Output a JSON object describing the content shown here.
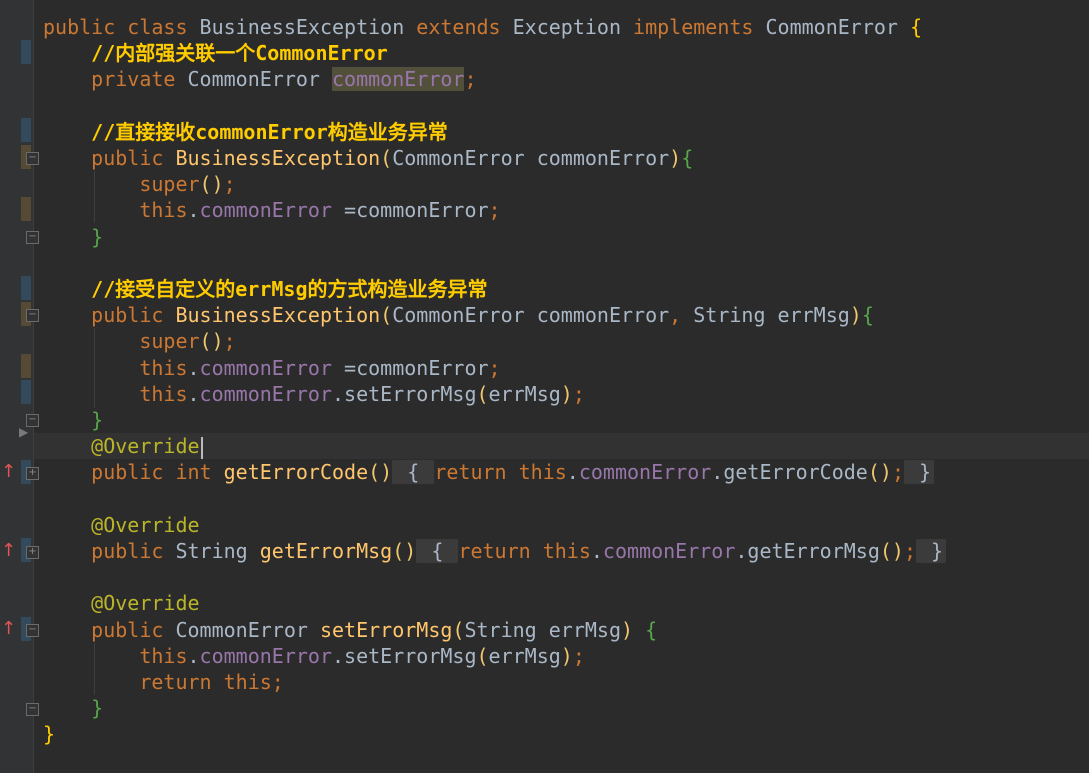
{
  "editor": {
    "lines": [
      {
        "parts": [
          {
            "c": "kw",
            "t": "public class "
          },
          {
            "c": "id",
            "t": "BusinessException "
          },
          {
            "c": "kw",
            "t": "extends "
          },
          {
            "c": "id",
            "t": "Exception "
          },
          {
            "c": "kw",
            "t": "implements "
          },
          {
            "c": "id",
            "t": "CommonError "
          },
          {
            "c": "brace1",
            "t": "{"
          }
        ]
      },
      {
        "parts": [
          {
            "c": "cmt",
            "t": "    //内部强关联一个CommonError"
          }
        ]
      },
      {
        "parts": [
          {
            "c": "kw",
            "t": "    private "
          },
          {
            "c": "id",
            "t": "CommonError "
          },
          {
            "c": "fld hl",
            "t": "commonError"
          },
          {
            "c": "pn",
            "t": ";"
          }
        ]
      },
      {
        "parts": []
      },
      {
        "parts": [
          {
            "c": "cmt",
            "t": "    //直接接收commonError构造业务异常"
          }
        ]
      },
      {
        "parts": [
          {
            "c": "kw",
            "t": "    public "
          },
          {
            "c": "fn",
            "t": "BusinessException"
          },
          {
            "c": "paren",
            "t": "("
          },
          {
            "c": "id",
            "t": "CommonError commonError"
          },
          {
            "c": "paren",
            "t": ")"
          },
          {
            "c": "brace2",
            "t": "{"
          }
        ]
      },
      {
        "parts": [
          {
            "c": "kw",
            "t": "        super"
          },
          {
            "c": "paren",
            "t": "()"
          },
          {
            "c": "pn",
            "t": ";"
          }
        ]
      },
      {
        "parts": [
          {
            "c": "kw",
            "t": "        this"
          },
          {
            "c": "id",
            "t": "."
          },
          {
            "c": "fld",
            "t": "commonError "
          },
          {
            "c": "id",
            "t": "=commonError"
          },
          {
            "c": "pn",
            "t": ";"
          }
        ]
      },
      {
        "parts": [
          {
            "c": "brace2",
            "t": "    }"
          }
        ]
      },
      {
        "parts": []
      },
      {
        "parts": [
          {
            "c": "cmt",
            "t": "    //接受自定义的errMsg的方式构造业务异常"
          }
        ]
      },
      {
        "parts": [
          {
            "c": "kw",
            "t": "    public "
          },
          {
            "c": "fn",
            "t": "BusinessException"
          },
          {
            "c": "paren",
            "t": "("
          },
          {
            "c": "id",
            "t": "CommonError commonError"
          },
          {
            "c": "pn",
            "t": ", "
          },
          {
            "c": "id",
            "t": "String errMsg"
          },
          {
            "c": "paren",
            "t": ")"
          },
          {
            "c": "brace2",
            "t": "{"
          }
        ]
      },
      {
        "parts": [
          {
            "c": "kw",
            "t": "        super"
          },
          {
            "c": "paren",
            "t": "()"
          },
          {
            "c": "pn",
            "t": ";"
          }
        ]
      },
      {
        "parts": [
          {
            "c": "kw",
            "t": "        this"
          },
          {
            "c": "id",
            "t": "."
          },
          {
            "c": "fld",
            "t": "commonError "
          },
          {
            "c": "id",
            "t": "=commonError"
          },
          {
            "c": "pn",
            "t": ";"
          }
        ]
      },
      {
        "parts": [
          {
            "c": "kw",
            "t": "        this"
          },
          {
            "c": "id",
            "t": "."
          },
          {
            "c": "fld",
            "t": "commonError"
          },
          {
            "c": "id",
            "t": ".setErrorMsg"
          },
          {
            "c": "paren",
            "t": "("
          },
          {
            "c": "id",
            "t": "errMsg"
          },
          {
            "c": "paren",
            "t": ")"
          },
          {
            "c": "pn",
            "t": ";"
          }
        ]
      },
      {
        "parts": [
          {
            "c": "brace2",
            "t": "    }"
          }
        ]
      },
      {
        "parts": [
          {
            "c": "ann",
            "t": "    @Override"
          }
        ],
        "caret": true
      },
      {
        "parts": [
          {
            "c": "kw",
            "t": "    public int "
          },
          {
            "c": "fn",
            "t": "getErrorCode"
          },
          {
            "c": "paren",
            "t": "()"
          },
          {
            "c": "fold",
            "t": " { "
          },
          {
            "c": "kw",
            "t": "return this"
          },
          {
            "c": "id",
            "t": "."
          },
          {
            "c": "fld",
            "t": "commonError"
          },
          {
            "c": "id",
            "t": ".getErrorCode"
          },
          {
            "c": "paren",
            "t": "()"
          },
          {
            "c": "pn",
            "t": ";"
          },
          {
            "c": "fold",
            "t": " }"
          }
        ]
      },
      {
        "parts": []
      },
      {
        "parts": [
          {
            "c": "ann",
            "t": "    @Override"
          }
        ]
      },
      {
        "parts": [
          {
            "c": "kw",
            "t": "    public "
          },
          {
            "c": "id",
            "t": "String "
          },
          {
            "c": "fn",
            "t": "getErrorMsg"
          },
          {
            "c": "paren",
            "t": "()"
          },
          {
            "c": "fold",
            "t": " { "
          },
          {
            "c": "kw",
            "t": "return this"
          },
          {
            "c": "id",
            "t": "."
          },
          {
            "c": "fld",
            "t": "commonError"
          },
          {
            "c": "id",
            "t": ".getErrorMsg"
          },
          {
            "c": "paren",
            "t": "()"
          },
          {
            "c": "pn",
            "t": ";"
          },
          {
            "c": "fold",
            "t": " }"
          }
        ]
      },
      {
        "parts": []
      },
      {
        "parts": [
          {
            "c": "ann",
            "t": "    @Override"
          }
        ]
      },
      {
        "parts": [
          {
            "c": "kw",
            "t": "    public "
          },
          {
            "c": "id",
            "t": "CommonError "
          },
          {
            "c": "fn",
            "t": "setErrorMsg"
          },
          {
            "c": "paren",
            "t": "("
          },
          {
            "c": "id",
            "t": "String errMsg"
          },
          {
            "c": "paren",
            "t": ")"
          },
          {
            "c": "id",
            "t": " "
          },
          {
            "c": "brace2",
            "t": "{"
          }
        ]
      },
      {
        "parts": [
          {
            "c": "kw",
            "t": "        this"
          },
          {
            "c": "id",
            "t": "."
          },
          {
            "c": "fld",
            "t": "commonError"
          },
          {
            "c": "id",
            "t": ".setErrorMsg"
          },
          {
            "c": "paren",
            "t": "("
          },
          {
            "c": "id",
            "t": "errMsg"
          },
          {
            "c": "paren",
            "t": ")"
          },
          {
            "c": "pn",
            "t": ";"
          }
        ]
      },
      {
        "parts": [
          {
            "c": "kw",
            "t": "        return this"
          },
          {
            "c": "pn",
            "t": ";"
          }
        ]
      },
      {
        "parts": [
          {
            "c": "brace2",
            "t": "    }"
          }
        ]
      },
      {
        "parts": [
          {
            "c": "brace1",
            "t": "}"
          }
        ]
      }
    ]
  },
  "gutter": {
    "override_icon": "override-up-arrow-icon",
    "fold_icon": "fold-toggle-icon",
    "run_icon": "play-arrow-icon"
  },
  "colors": {
    "background": "#2b2b2b",
    "keyword": "#cc7832",
    "method": "#ffc66d",
    "field": "#9876aa",
    "comment": "#ffcc00",
    "annotation": "#bbb529"
  }
}
